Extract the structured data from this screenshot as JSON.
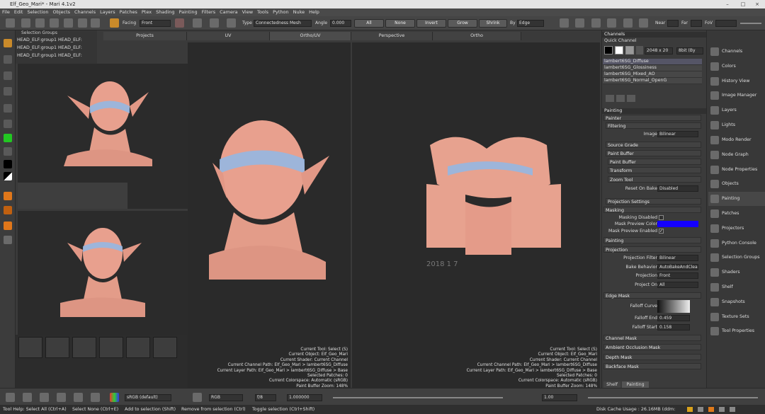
{
  "window": {
    "title": "Elf_Geo_Mari* - Mari 4.1v2"
  },
  "menu": [
    "File",
    "Edit",
    "Selection",
    "Objects",
    "Channels",
    "Layers",
    "Patches",
    "Ptex",
    "Shading",
    "Painting",
    "Filters",
    "Camera",
    "View",
    "Tools",
    "Python",
    "Nuke",
    "Help"
  ],
  "toolbar": {
    "facing_label": "Facing",
    "facing_value": "Front",
    "type_label": "Type",
    "type_value": "Connectedness Mesh",
    "angle_label": "Angle",
    "angle_value": "0.000",
    "all_btn": "All",
    "none_btn": "None",
    "invert_btn": "Invert",
    "grow_btn": "Grow",
    "shrink_btn": "Shrink",
    "by_label": "By",
    "by_value": "Edge",
    "near_label": "Near",
    "far_label": "Far",
    "fov_label": "FoV"
  },
  "selection_groups": {
    "header": "Selection Groups",
    "rows": [
      "HEAD_ELF:group1 HEAD_ELF:",
      "HEAD_ELF:group1 HEAD_ELF:",
      "HEAD_ELF:group1 HEAD_ELF:"
    ]
  },
  "view_tabs": [
    "Projects",
    "UV",
    "Ortho/UV",
    "Perspective",
    "Ortho"
  ],
  "viewport_status": {
    "main": [
      "Current Tool: Select (S)",
      "Current Object: Elf_Geo_Mari",
      "Current Shader: Current Channel",
      "Current Channel Path: Elf_Geo_Mari > lambert6SG_Diffuse",
      "Current Layer Path: Elf_Geo_Mari > lambert6SG_Diffuse > Base",
      "Selected Patches: 0",
      "Current Colorspace: Automatic (sRGB)",
      "Paint Buffer Zoom: 148%"
    ],
    "uv": [
      "Current Tool: Select (S)",
      "Current Object: Elf_Geo_Mari",
      "Current Shader: Current Channel",
      "Current Channel Path: Elf_Geo_Mari > lambert6SG_Diffuse",
      "Current Layer Path: Elf_Geo_Mari > lambert6SG_Diffuse > Base",
      "Selected Patches: 0",
      "Current Colorspace: Automatic (sRGB)",
      "Paint Buffer Zoom: 148%"
    ]
  },
  "channels_panel": {
    "title": "Channels",
    "quick_channel": "Quick Channel",
    "size": "2048 x 20",
    "depth": "8bit (By",
    "channels": [
      "lambert6SG_Diffuse",
      "lambert6SG_Glossiness",
      "lambert6SG_Mixed_AO",
      "lambert6SG_Normal_OpenG"
    ]
  },
  "painting_panel": {
    "title": "Painting",
    "painter": "Painter",
    "filtering": "Filtering",
    "image_label": "Image",
    "image_value": "Bilinear",
    "source_grade": "Source Grade",
    "paint_buffer": "Paint Buffer",
    "paint_buffer_sub": "Paint Buffer",
    "transform": "Transform",
    "zoom_tool": "Zoom Tool",
    "reset_on_bake_label": "Reset On Bake",
    "reset_on_bake_value": "Disabled",
    "projection_settings": "Projection Settings",
    "masking": "Masking",
    "masking_disabled": "Masking Disabled",
    "mask_preview_color": "Mask Preview Color",
    "mask_preview_color_value": "#1400ff",
    "mask_preview_enabled": "Mask Preview Enabled",
    "painting": "Painting",
    "projection": "Projection",
    "projection_filter_label": "Projection Filter",
    "projection_filter_value": "Bilinear",
    "bake_behavior_label": "Bake Behavior",
    "bake_behavior_value": "AutoBakeAndClea",
    "projection_label": "Projection",
    "projection_value": "Front",
    "project_on_label": "Project On",
    "project_on_value": "All",
    "edge_mask": "Edge Mask",
    "falloff_curve": "Falloff Curve",
    "falloff_end_label": "Falloff End",
    "falloff_end_value": "0.459",
    "falloff_start_label": "Falloff Start",
    "falloff_start_value": "0.158",
    "channel_mask": "Channel Mask",
    "ao_mask": "Ambient Occlusion Mask",
    "depth_mask": "Depth Mask",
    "backface_mask": "Backface Mask",
    "tab_shelf": "Shelf",
    "tab_painting": "Painting"
  },
  "right_palettes": [
    "Channels",
    "Colors",
    "History View",
    "Image Manager",
    "Layers",
    "Lights",
    "Modo Render",
    "Node Graph",
    "Node Properties",
    "Objects",
    "Painting",
    "Patches",
    "Projectors",
    "Python Console",
    "Selection Groups",
    "Shaders",
    "Shelf",
    "Snapshots",
    "Texture Sets",
    "Tool Properties"
  ],
  "bottom": {
    "colorspace": "sRGB (default)",
    "view_mode": "RGB",
    "fstop": "f/8",
    "exposure": "1.000000",
    "gamma": "1.00"
  },
  "statusbar": {
    "tool_help": "Tool Help: Select All (Ctrl+A)",
    "select_none": "Select None (Ctrl+E)",
    "add_sel": "Add to selection (Shift)",
    "remove_sel": "Remove from selection (Ctrl)",
    "toggle_sel": "Toggle selection (Ctrl+Shift)",
    "disk_cache": "Disk Cache Usage : 26.16MB (ddm:"
  },
  "watermark": "2018 1 7"
}
